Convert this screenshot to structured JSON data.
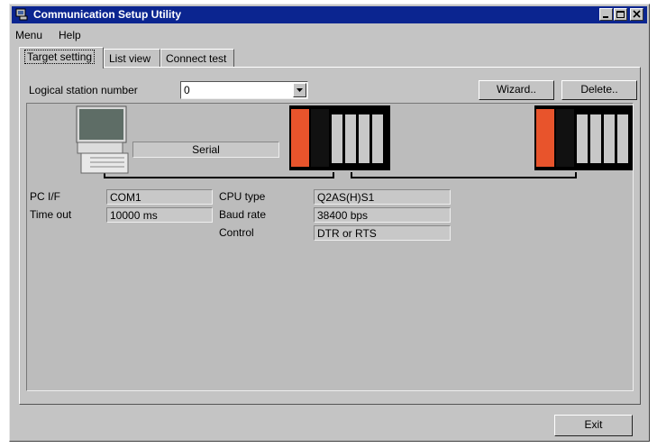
{
  "window": {
    "title": "Communication Setup Utility"
  },
  "menu": {
    "items": [
      "Menu",
      "Help"
    ]
  },
  "tabs": [
    {
      "label": "Target setting",
      "active": true
    },
    {
      "label": "List view",
      "active": false
    },
    {
      "label": "Connect test",
      "active": false
    }
  ],
  "station": {
    "label": "Logical station number",
    "value": "0"
  },
  "buttons": {
    "wizard": "Wizard..",
    "delete": "Delete..",
    "exit": "Exit"
  },
  "diagram": {
    "connection": "Serial",
    "pc": [
      {
        "label": "PC I/F",
        "value": "COM1"
      },
      {
        "label": "Time out",
        "value": "10000 ms"
      }
    ],
    "plc": [
      {
        "label": "CPU type",
        "value": "Q2AS(H)S1"
      },
      {
        "label": "Baud rate",
        "value": "38400 bps"
      },
      {
        "label": "Control",
        "value": "DTR or RTS"
      }
    ]
  },
  "colors": {
    "titlebar": "#0b2590",
    "cpu_module": "#e8542c",
    "window_bg": "#c4c4c4"
  }
}
